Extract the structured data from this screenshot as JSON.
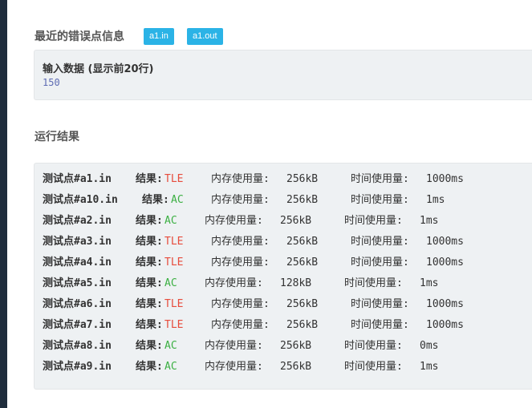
{
  "recent_error": {
    "title": "最近的错误点信息",
    "tags": [
      "a1.in",
      "a1.out"
    ],
    "input_label": "输入数据 (显示前20行)",
    "input_value": "150"
  },
  "result": {
    "title": "运行结果",
    "verdict_prefix": "结果:",
    "mem_prefix": "内存使用量:",
    "time_prefix": "时间使用量:",
    "rows": [
      {
        "test": "测试点#a1.in",
        "verdict": "TLE",
        "mem": "256kB",
        "time": "1000ms"
      },
      {
        "test": "测试点#a10.in",
        "verdict": "AC",
        "mem": "256kB",
        "time": "1ms"
      },
      {
        "test": "测试点#a2.in",
        "verdict": "AC",
        "mem": "256kB",
        "time": "1ms"
      },
      {
        "test": "测试点#a3.in",
        "verdict": "TLE",
        "mem": "256kB",
        "time": "1000ms"
      },
      {
        "test": "测试点#a4.in",
        "verdict": "TLE",
        "mem": "256kB",
        "time": "1000ms"
      },
      {
        "test": "测试点#a5.in",
        "verdict": "AC",
        "mem": "128kB",
        "time": "1ms"
      },
      {
        "test": "测试点#a6.in",
        "verdict": "TLE",
        "mem": "256kB",
        "time": "1000ms"
      },
      {
        "test": "测试点#a7.in",
        "verdict": "TLE",
        "mem": "256kB",
        "time": "1000ms"
      },
      {
        "test": "测试点#a8.in",
        "verdict": "AC",
        "mem": "256kB",
        "time": "0ms"
      },
      {
        "test": "测试点#a9.in",
        "verdict": "AC",
        "mem": "256kB",
        "time": "1ms"
      }
    ]
  },
  "colors": {
    "tag_bg": "#2bb3e6",
    "tle": "#e74c3c",
    "ac": "#3cb043",
    "sidebar": "#1f2d3d"
  }
}
